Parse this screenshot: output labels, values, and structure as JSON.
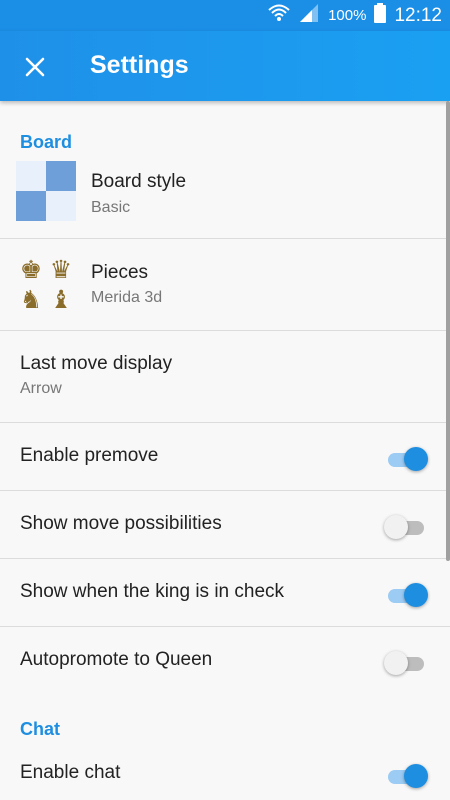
{
  "status_bar": {
    "battery": "100%",
    "time": "12:12"
  },
  "app_bar": {
    "title": "Settings"
  },
  "sections": {
    "board": {
      "header": "Board",
      "board_style": {
        "title": "Board style",
        "value": "Basic"
      },
      "pieces": {
        "title": "Pieces",
        "value": "Merida 3d"
      },
      "last_move": {
        "title": "Last move display",
        "value": "Arrow"
      },
      "premove": {
        "title": "Enable premove",
        "enabled": true
      },
      "move_possibilities": {
        "title": "Show move possibilities",
        "enabled": false
      },
      "king_check": {
        "title": "Show when the king is in check",
        "enabled": true
      },
      "autopromote": {
        "title": "Autopromote to Queen",
        "enabled": false
      }
    },
    "chat": {
      "header": "Chat",
      "enable_chat": {
        "title": "Enable chat",
        "enabled": true
      }
    }
  },
  "colors": {
    "accent": "#1e8ee0",
    "board_light": "#e7f0fb",
    "board_dark": "#6f9fd8"
  }
}
